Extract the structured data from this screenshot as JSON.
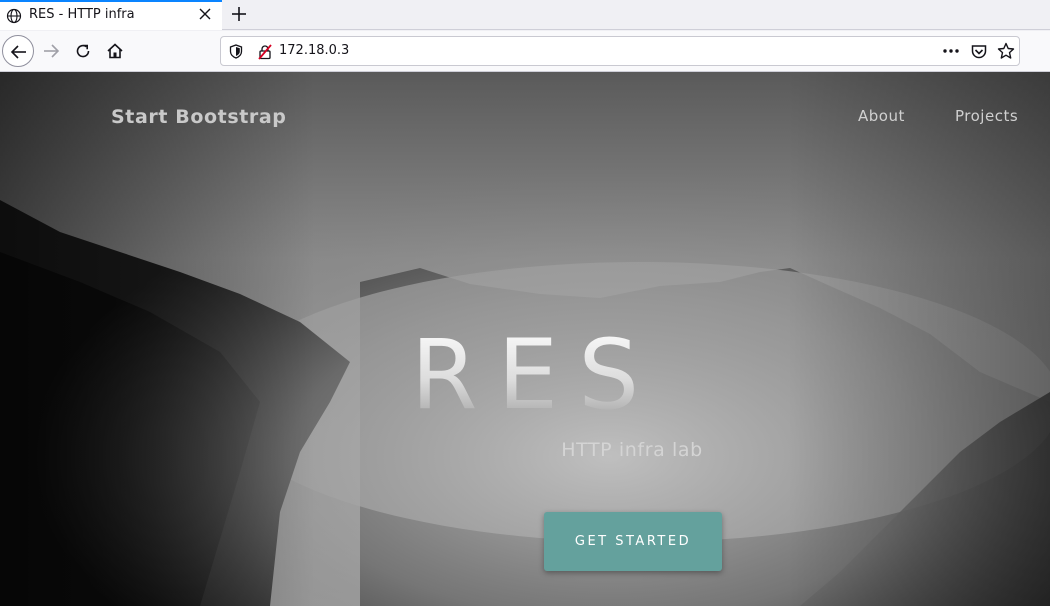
{
  "browser": {
    "tab": {
      "title": "RES - HTTP infra",
      "icon": "globe-icon"
    },
    "new_tab_icon": "plus-icon",
    "url": "172.18.0.3",
    "toolbar_icons": [
      "back-arrow-icon",
      "forward-arrow-icon",
      "reload-icon",
      "home-icon",
      "shield-icon",
      "insecure-lock-icon",
      "more-dots-icon",
      "pocket-icon",
      "star-icon"
    ]
  },
  "site": {
    "brand": "Start Bootstrap",
    "nav": {
      "about": "About",
      "projects": "Projects"
    },
    "hero": {
      "title": "RES",
      "subtitle": "HTTP infra lab",
      "cta": "GET STARTED"
    }
  },
  "colors": {
    "accent": "#64a19d",
    "tab_highlight": "#0a84ff"
  }
}
